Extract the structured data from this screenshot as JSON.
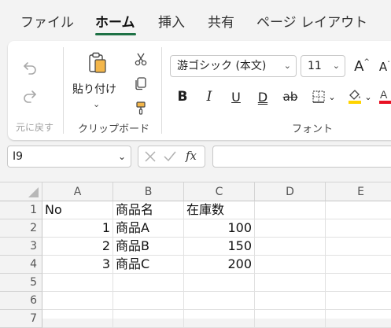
{
  "tabs": [
    {
      "label": "ファイル",
      "active": false
    },
    {
      "label": "ホーム",
      "active": true
    },
    {
      "label": "挿入",
      "active": false
    },
    {
      "label": "共有",
      "active": false
    },
    {
      "label": "ページ レイアウト",
      "active": false
    }
  ],
  "ribbon": {
    "undo_group_label": "元に戻す",
    "clipboard": {
      "paste_label": "貼り付け",
      "group_label": "クリップボード"
    },
    "font": {
      "font_name": "游ゴシック (本文)",
      "font_size": "11",
      "group_label": "フォント"
    }
  },
  "formula_bar": {
    "name_box": "I9",
    "fx_label": "fx",
    "formula": ""
  },
  "sheet": {
    "columns": [
      "A",
      "B",
      "C",
      "D",
      "E"
    ],
    "rows": [
      "1",
      "2",
      "3",
      "4",
      "5",
      "6",
      "7"
    ],
    "cells": [
      [
        "No",
        "商品名",
        "在庫数",
        "",
        ""
      ],
      [
        "1",
        "商品A",
        "100",
        "",
        ""
      ],
      [
        "2",
        "商品B",
        "150",
        "",
        ""
      ],
      [
        "3",
        "商品C",
        "200",
        "",
        ""
      ],
      [
        "",
        "",
        "",
        "",
        ""
      ],
      [
        "",
        "",
        "",
        "",
        ""
      ],
      [
        "",
        "",
        "",
        "",
        ""
      ]
    ]
  },
  "colors": {
    "accent": "#1e7145",
    "highlight_yellow": "#ffd400",
    "font_red": "#e81123"
  }
}
